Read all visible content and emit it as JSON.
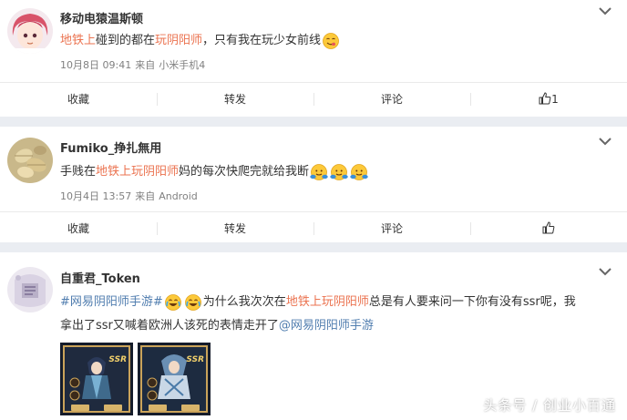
{
  "posts": [
    {
      "username": "移动电猿温斯顿",
      "content": [
        {
          "type": "text",
          "cls": "red",
          "text": "地铁上"
        },
        {
          "type": "text",
          "cls": "",
          "text": "碰到的都在"
        },
        {
          "type": "text",
          "cls": "red",
          "text": "玩阴阳师"
        },
        {
          "type": "text",
          "cls": "",
          "text": "，只有我在玩少女前线"
        },
        {
          "type": "emoji",
          "icon": "yum-emoji"
        }
      ],
      "time": "10月8日 09:41",
      "source_prefix": "来自",
      "source": "小米手机4",
      "actions": {
        "favorite": "收藏",
        "repost": "转发",
        "comment": "评论",
        "like_count": "1"
      }
    },
    {
      "username": "Fumiko_挣扎無用",
      "content": [
        {
          "type": "text",
          "cls": "",
          "text": "手贱在"
        },
        {
          "type": "text",
          "cls": "red",
          "text": "地铁上玩阴阳师"
        },
        {
          "type": "text",
          "cls": "",
          "text": "妈的每次快爬完就给我断"
        },
        {
          "type": "emoji",
          "icon": "hug-emoji"
        },
        {
          "type": "emoji",
          "icon": "hug-emoji"
        },
        {
          "type": "emoji",
          "icon": "hug-emoji"
        }
      ],
      "time": "10月4日 13:57",
      "source_prefix": "来自",
      "source": "Android",
      "actions": {
        "favorite": "收藏",
        "repost": "转发",
        "comment": "评论",
        "like_count": ""
      }
    },
    {
      "username": "自重君_Token",
      "lines": [
        [
          {
            "type": "text",
            "cls": "blue",
            "text": "#网易阴阳师手游#"
          },
          {
            "type": "emoji",
            "icon": "laugh-cry-emoji"
          },
          {
            "type": "emoji",
            "icon": "laugh-cry-emoji"
          },
          {
            "type": "text",
            "cls": "",
            "text": "为什么我次次在"
          },
          {
            "type": "text",
            "cls": "red",
            "text": "地铁上玩阴阳师"
          },
          {
            "type": "text",
            "cls": "",
            "text": "总是有人要来问一下你有没有ssr呢，我"
          }
        ],
        [
          {
            "type": "text",
            "cls": "",
            "text": "拿出了ssr又喊着欧洲人该死的表情走开了"
          },
          {
            "type": "text",
            "cls": "blue",
            "text": "@网易阴阳师手游"
          }
        ]
      ],
      "images": [
        {
          "label": "SSR",
          "name": "game-screenshot-1"
        },
        {
          "label": "SSR",
          "name": "game-screenshot-2"
        }
      ]
    }
  ],
  "watermark": "头条号 / 创业小百通",
  "colors": {
    "highlight": "#eb7350",
    "link": "#507daf",
    "meta": "#808080",
    "background": "#eaedf2"
  }
}
